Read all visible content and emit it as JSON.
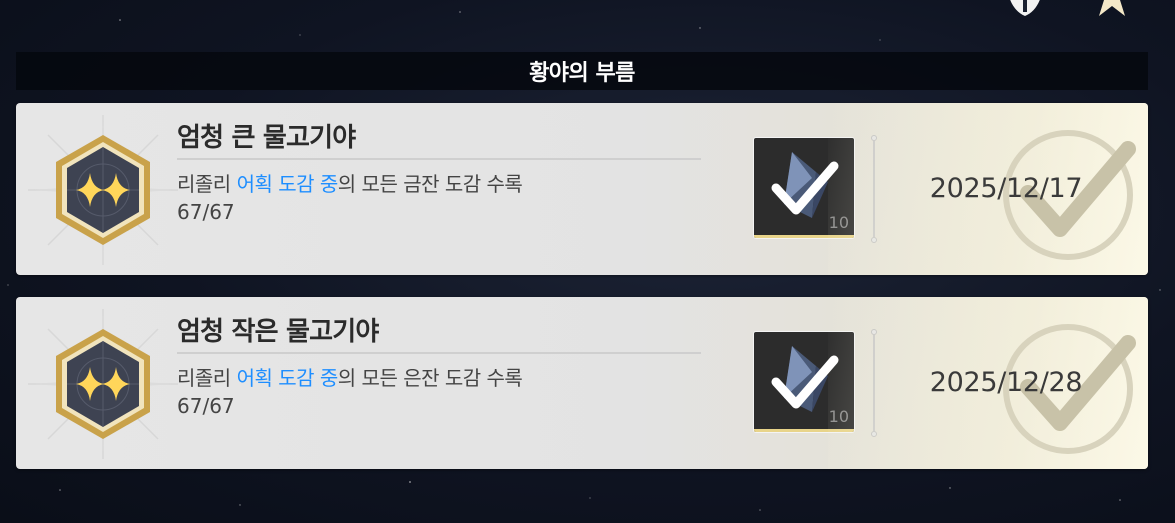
{
  "header": {
    "title": "황야의 부름"
  },
  "achievements": [
    {
      "title": "엄청 큰 물고기야",
      "desc_prefix": "리졸리 ",
      "desc_highlight": "어획 도감 중",
      "desc_suffix": "의 모든 금잔 도감 수록",
      "progress": "67/67",
      "reward_count": "10",
      "date": "2025/12/17"
    },
    {
      "title": "엄청 작은 물고기야",
      "desc_prefix": "리졸리 ",
      "desc_highlight": "어획 도감 중",
      "desc_suffix": "의 모든 은잔 도감 수록",
      "progress": "67/67",
      "reward_count": "10",
      "date": "2025/12/28"
    }
  ],
  "colors": {
    "highlight": "#1e8eff",
    "card_bg": "#e4e4e4",
    "badge_gold": "#c9a24a"
  },
  "icons": {
    "badge": "hexagon-sparkle-badge-icon",
    "reward": "crystal-checkmark-reward-icon",
    "completed": "completed-check-stamp-icon"
  }
}
